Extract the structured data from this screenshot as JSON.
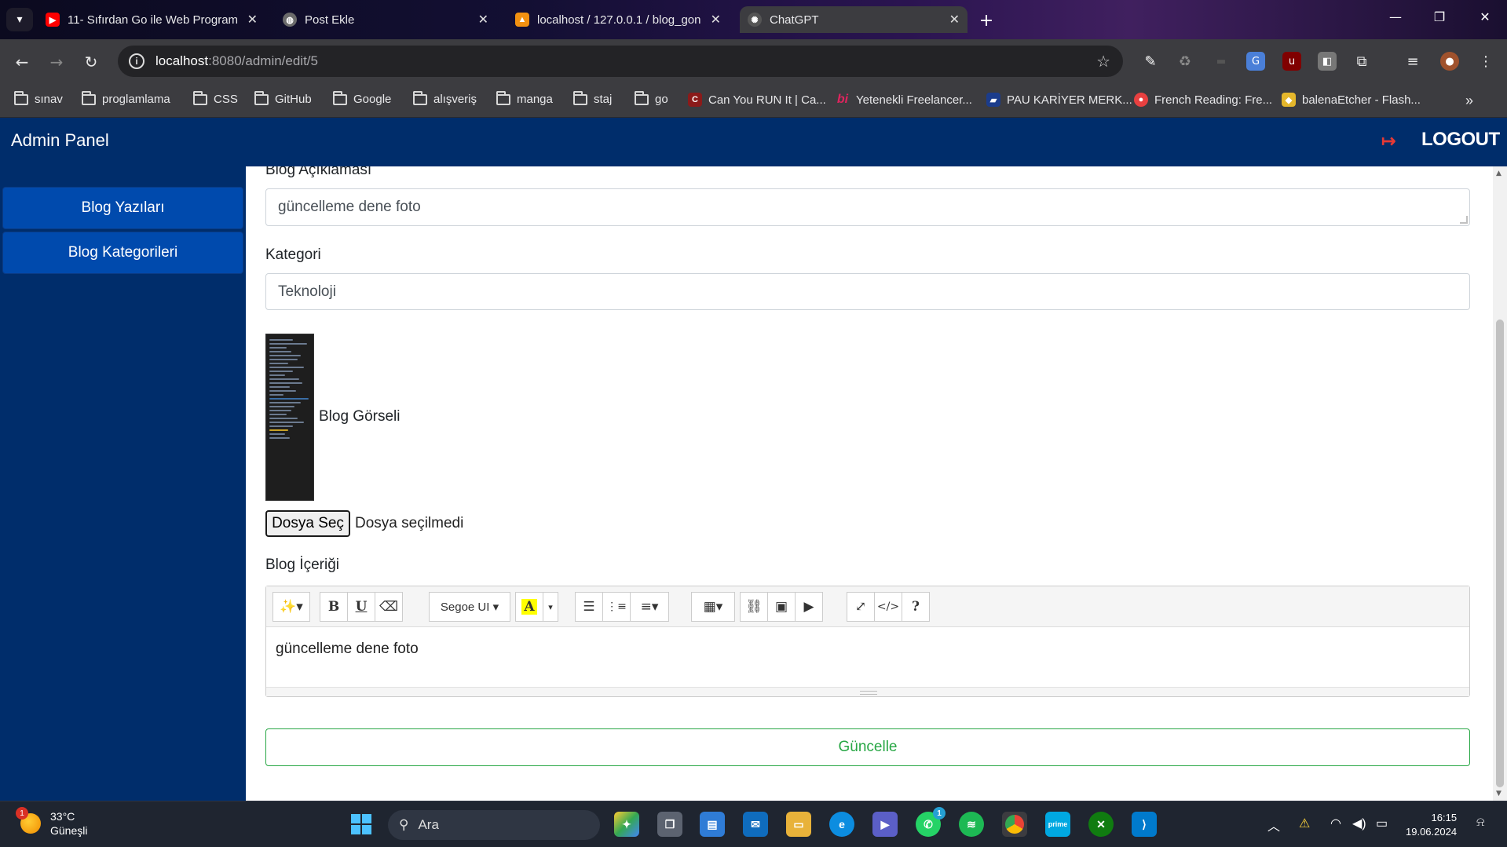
{
  "browser": {
    "tabs": [
      {
        "label": "11- Sıfırdan Go ile Web Program",
        "favicon": "youtube-icon",
        "active": false
      },
      {
        "label": "Post Ekle",
        "favicon": "globe-icon",
        "active": false
      },
      {
        "label": "localhost / 127.0.0.1 / blog_gon",
        "favicon": "phpmyadmin-icon",
        "active": false
      },
      {
        "label": "ChatGPT",
        "favicon": "chatgpt-icon",
        "active": true
      }
    ],
    "url_host": "localhost",
    "url_rest": ":8080/admin/edit/5",
    "bookmarks": [
      {
        "label": "sınav",
        "icon": "folder-icon"
      },
      {
        "label": "proglamlama",
        "icon": "folder-icon"
      },
      {
        "label": "CSS",
        "icon": "folder-icon"
      },
      {
        "label": "GitHub",
        "icon": "folder-icon"
      },
      {
        "label": "Google",
        "icon": "folder-icon"
      },
      {
        "label": "alışveriş",
        "icon": "folder-icon"
      },
      {
        "label": "manga",
        "icon": "folder-icon"
      },
      {
        "label": "staj",
        "icon": "folder-icon"
      },
      {
        "label": "go",
        "icon": "folder-icon"
      },
      {
        "label": "Can You RUN It | Ca...",
        "icon": "canyourunit-icon"
      },
      {
        "label": "Yetenekli Freelancer...",
        "icon": "bionluk-icon"
      },
      {
        "label": "PAU KARİYER MERK...",
        "icon": "pau-icon"
      },
      {
        "label": "French Reading: Fre...",
        "icon": "french-reading-icon"
      },
      {
        "label": "balenaEtcher - Flash...",
        "icon": "balena-icon"
      }
    ]
  },
  "app": {
    "brand": "Admin Panel",
    "logout": "LOGOUT",
    "sidebar": [
      {
        "label": "Blog Yazıları"
      },
      {
        "label": "Blog Kategorileri"
      }
    ]
  },
  "form": {
    "description_label": "Blog Açıklaması",
    "description_value": "güncelleme dene foto",
    "category_label": "Kategori",
    "category_value": "Teknoloji",
    "image_label": "Blog Görseli",
    "file_button": "Dosya Seç",
    "file_status": "Dosya seçilmedi",
    "content_label": "Blog İçeriği",
    "editor_font": "Segoe UI",
    "editor_content": "güncelleme dene foto",
    "submit_label": "Güncelle"
  },
  "editor_toolbar": [
    "magic-icon",
    "bold-icon",
    "underline-icon",
    "eraser-icon",
    "font-name-dropdown",
    "color-icon",
    "color-dropdown",
    "unordered-list-icon",
    "ordered-list-icon",
    "align-icon",
    "table-icon",
    "link-icon",
    "picture-icon",
    "video-icon",
    "fullscreen-icon",
    "code-view-icon",
    "help-icon"
  ],
  "taskbar": {
    "temperature": "33°C",
    "weather": "Güneşli",
    "weather_badge": "1",
    "search_placeholder": "Ara",
    "whatsapp_badge": "1",
    "time": "16:15",
    "date": "19.06.2024"
  },
  "colors": {
    "navbar": "#002d6b",
    "sidebar_item": "#004aad",
    "submit_green": "#28a745",
    "logout_icon": "#e53935"
  }
}
